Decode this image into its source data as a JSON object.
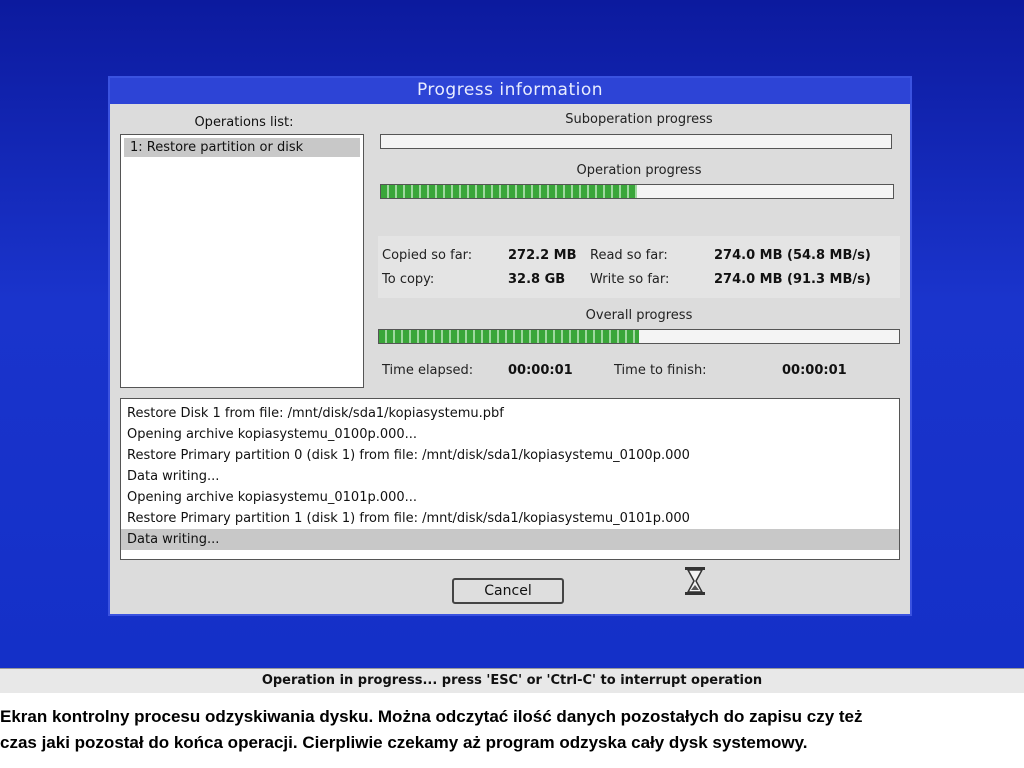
{
  "dialog": {
    "title": "Progress information",
    "operations_label": "Operations list:",
    "operations": [
      "1: Restore partition or disk"
    ],
    "suboperation_label": "Suboperation progress",
    "suboperation_progress": 0.0,
    "operation_label": "Operation progress",
    "operation_progress": 0.5,
    "overall_label": "Overall progress",
    "overall_progress": 0.5,
    "stats": {
      "copied_label": "Copied so far:",
      "copied_value": "272.2 MB",
      "to_copy_label": "To copy:",
      "to_copy_value": "32.8 GB",
      "read_label": "Read so far:",
      "read_value": "274.0 MB (54.8 MB/s)",
      "write_label": "Write so far:",
      "write_value": "274.0 MB (91.3 MB/s)"
    },
    "time": {
      "elapsed_label": "Time elapsed:",
      "elapsed_value": "00:00:01",
      "finish_label": "Time to finish:",
      "finish_value": "00:00:01"
    },
    "log": [
      "Restore Disk 1 from file: /mnt/disk/sda1/kopiasystemu.pbf",
      "Opening archive kopiasystemu_0100p.000...",
      "Restore Primary partition 0 (disk 1) from file: /mnt/disk/sda1/kopiasystemu_0100p.000",
      "Data writing...",
      "Opening archive kopiasystemu_0101p.000...",
      "Restore Primary partition 1 (disk 1) from file: /mnt/disk/sda1/kopiasystemu_0101p.000",
      "Data writing..."
    ],
    "cancel_label": "Cancel",
    "busy_icon": "hourglass-icon"
  },
  "status_bar": "Operation in progress... press 'ESC' or 'Ctrl-C' to interrupt operation",
  "caption": {
    "line1": "Ekran kontrolny procesu odzyskiwania dysku. Można odczytać ilość danych pozostałych do zapisu czy też",
    "line2": "czas jaki pozostał do końca operacji. Cierpliwie czekamy aż program odzyska cały dysk systemowy."
  },
  "colors": {
    "desktop": "#1a34cc",
    "title_bar": "#2d44d6",
    "dialog_bg": "#dcdcdc",
    "progress_fill": "#3aa63a"
  }
}
